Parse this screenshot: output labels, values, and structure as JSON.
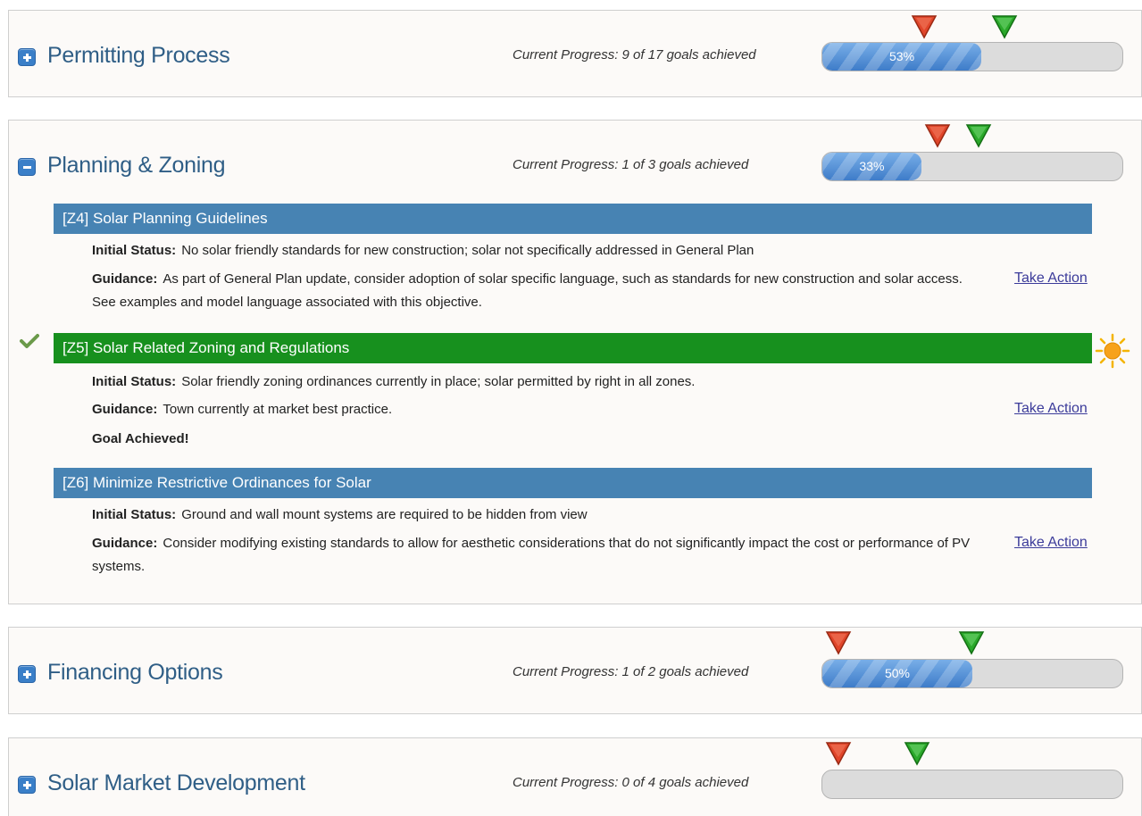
{
  "sections": [
    {
      "title": "Permitting Process",
      "expanded": false,
      "progress_text": "Current Progress: 9 of 17 goals achieved",
      "percent_label": "53%",
      "percent": 53
    },
    {
      "title": "Planning & Zoning",
      "expanded": true,
      "progress_text": "Current Progress: 1 of 3 goals achieved",
      "percent_label": "33%",
      "percent": 33,
      "items": [
        {
          "title": "[Z4] Solar Planning Guidelines",
          "status": "blue",
          "initial_status_label": "Initial Status:",
          "initial_status": "No solar friendly standards for new construction; solar not specifically addressed in General Plan",
          "guidance_label": "Guidance:",
          "guidance": "As part of General Plan update, consider adoption of solar specific language, such as standards for new construction and solar access. See examples and model language associated with this objective.",
          "action": "Take Action"
        },
        {
          "title": "[Z5] Solar Related Zoning and Regulations",
          "status": "green",
          "initial_status_label": "Initial Status:",
          "initial_status": "Solar friendly zoning ordinances currently in place; solar permitted by right in all zones.",
          "guidance_label": "Guidance:",
          "guidance": "Town currently at market best practice.",
          "achieved": "Goal Achieved!",
          "action": "Take Action"
        },
        {
          "title": "[Z6] Minimize Restrictive Ordinances for Solar",
          "status": "blue",
          "initial_status_label": "Initial Status:",
          "initial_status": "Ground and wall mount systems are required to be hidden from view",
          "guidance_label": "Guidance:",
          "guidance": "Consider modifying existing standards to allow for aesthetic considerations that do not significantly impact the cost or performance of PV systems.",
          "action": "Take Action"
        }
      ]
    },
    {
      "title": "Financing Options",
      "expanded": false,
      "progress_text": "Current Progress: 1 of 2 goals achieved",
      "percent_label": "50%",
      "percent": 50
    },
    {
      "title": "Solar Market Development",
      "expanded": false,
      "progress_text": "Current Progress: 0 of 4 goals achieved",
      "percent_label": "",
      "percent": 0
    }
  ],
  "colors": {
    "item_blue": "#4783b3",
    "item_green": "#17901e",
    "progress_fill": "#4a8ad6",
    "title_text": "#2f5e86",
    "marker_red": "#e0452a",
    "marker_green": "#2aa82a"
  },
  "icons": {
    "expand": "plus-icon",
    "collapse": "minus-icon",
    "marker_low": "red-triangle-marker-icon",
    "marker_high": "green-triangle-marker-icon",
    "achieved": "checkmark-icon",
    "featured": "sun-icon"
  }
}
